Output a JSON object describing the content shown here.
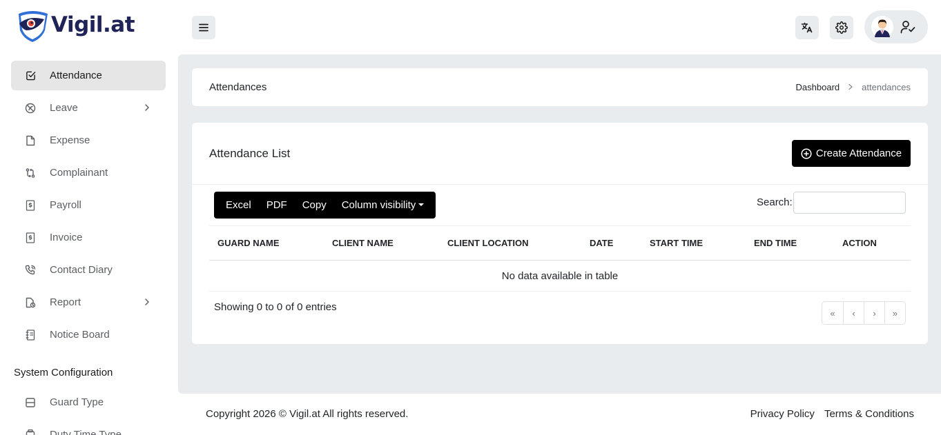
{
  "brand": {
    "name": "Vigil.at"
  },
  "sidebar": {
    "items": [
      {
        "label": "Attendance",
        "icon": "checkbox-icon",
        "active": true
      },
      {
        "label": "Leave",
        "icon": "leave-icon",
        "has_children": true
      },
      {
        "label": "Expense",
        "icon": "file-icon"
      },
      {
        "label": "Complainant",
        "icon": "transfer-icon"
      },
      {
        "label": "Payroll",
        "icon": "payroll-icon"
      },
      {
        "label": "Invoice",
        "icon": "invoice-icon"
      },
      {
        "label": "Contact Diary",
        "icon": "phone-icon"
      },
      {
        "label": "Report",
        "icon": "report-icon",
        "has_children": true
      },
      {
        "label": "Notice Board",
        "icon": "notebook-icon"
      }
    ],
    "section_title": "System Configuration",
    "config_items": [
      {
        "label": "Guard Type",
        "icon": "layout-icon"
      },
      {
        "label": "Duty Time Type",
        "icon": "clock-icon"
      }
    ]
  },
  "header": {
    "translate_icon": "translate-icon",
    "settings_icon": "gear-icon",
    "user_icon": "user-check-icon"
  },
  "breadcrumb": {
    "title": "Attendances",
    "trail": [
      "Dashboard",
      "attendances"
    ]
  },
  "list": {
    "title": "Attendance List",
    "create_label": "Create Attendance",
    "export_buttons": [
      "Excel",
      "PDF",
      "Copy",
      "Column visibility"
    ],
    "search_label": "Search:",
    "search_value": "",
    "columns": [
      "GUARD NAME",
      "CLIENT NAME",
      "CLIENT LOCATION",
      "DATE",
      "START TIME",
      "END TIME",
      "ACTION"
    ],
    "empty_message": "No data available in table",
    "info": "Showing 0 to 0 of 0 entries",
    "pager": [
      "«",
      "‹",
      "›",
      "»"
    ]
  },
  "footer": {
    "copyright": "Copyright 2026 © Vigil.at All rights reserved.",
    "links": [
      "Privacy Policy",
      "Terms & Conditions"
    ]
  },
  "colors": {
    "brand_navy": "#1f2357",
    "brand_blue": "#2f6fd6",
    "primary_button": "#000000",
    "content_bg": "#e9ecef",
    "active_nav_bg": "#e6e6e6"
  }
}
